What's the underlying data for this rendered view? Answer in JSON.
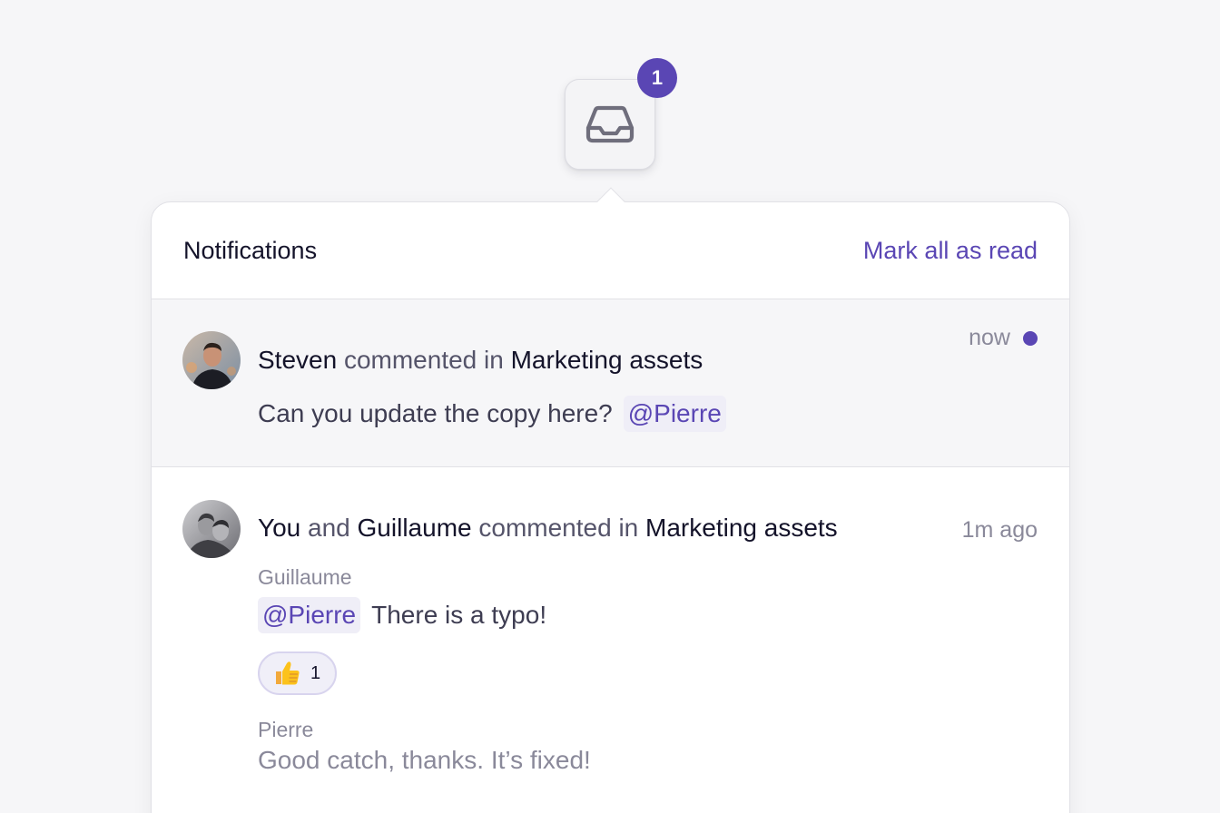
{
  "inbox": {
    "icon": "inbox-tray-icon",
    "badge_count": "1"
  },
  "popover": {
    "title": "Notifications",
    "mark_all_read": "Mark all as read"
  },
  "notifications": [
    {
      "actor": "Steven",
      "verb": "commented in",
      "target": "Marketing assets",
      "time": "now",
      "unread": true,
      "message": "Can you update the copy here?",
      "mention": "@Pierre"
    },
    {
      "actor_1": "You",
      "conjunction": "and",
      "actor_2": "Guillaume",
      "verb": "commented in",
      "target": "Marketing assets",
      "time": "1m ago",
      "unread": false,
      "comments": [
        {
          "author": "Guillaume",
          "mention": "@Pierre",
          "text": "There is a typo!",
          "reaction": {
            "emoji": "thumbs-up-icon",
            "count": "1"
          }
        },
        {
          "author": "Pierre",
          "text": "Good catch, thanks. It’s fixed!"
        }
      ]
    }
  ],
  "colors": {
    "accent": "#5a46b4",
    "background": "#f6f6f8",
    "text_primary": "#14132a",
    "text_muted": "#8a899a"
  }
}
